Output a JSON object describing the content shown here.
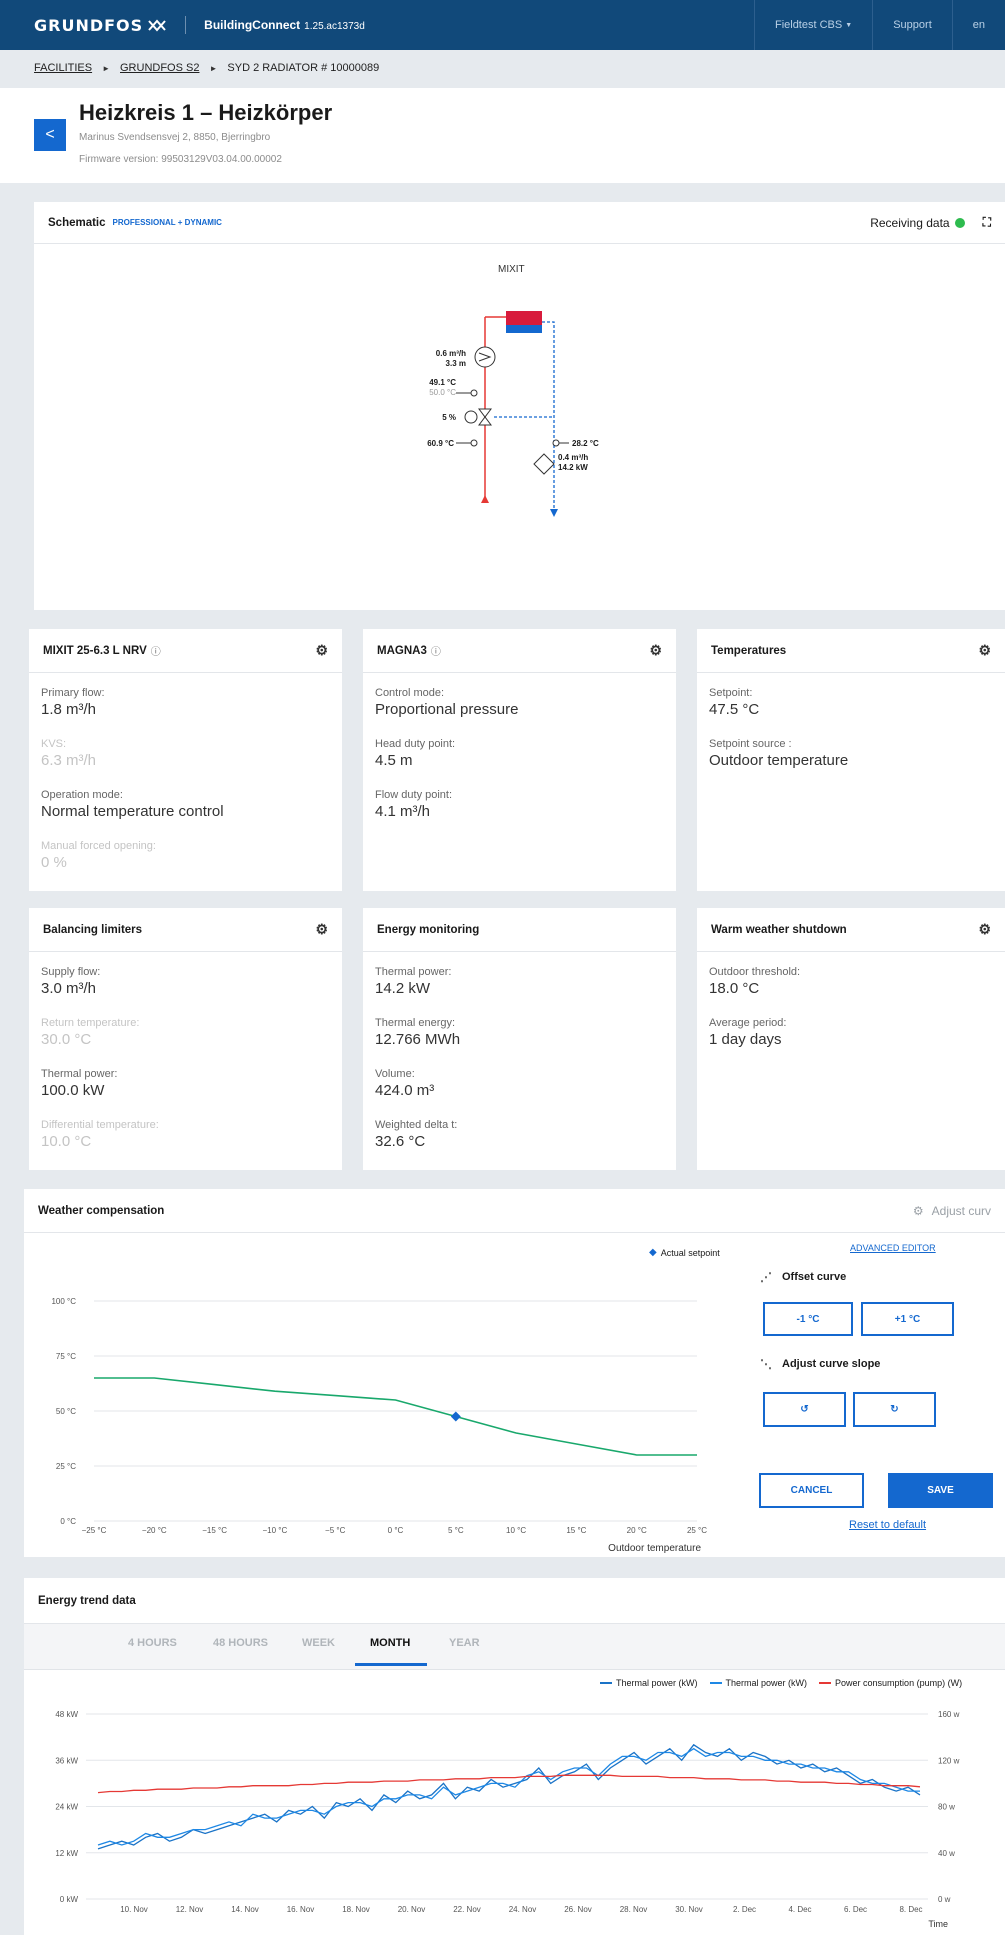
{
  "topbar": {
    "logo": "GRUNDFOS",
    "app_name": "BuildingConnect",
    "app_version": "1.25.ac1373d",
    "user_menu": "Fieldtest CBS",
    "support": "Support",
    "language": "en"
  },
  "breadcrumb": {
    "items": [
      "FACILITIES",
      "GRUNDFOS S2",
      "SYD 2 RADIATOR # 10000089"
    ]
  },
  "header": {
    "title": "Heizkreis 1 – Heizkörper",
    "address": "Marinus Svendsensvej 2, 8850, Bjerringbro",
    "firmware": "Firmware version: 99503129V03.04.00.00002"
  },
  "schematic": {
    "title": "Schematic",
    "badge": "PROFESSIONAL + DYNAMIC",
    "status": "Receiving data",
    "status_color": "#2dbb4e",
    "diagram_title": "MIXIT",
    "labels": {
      "pump_flow": "0.6 m³/h",
      "pump_head": "3.3 m",
      "temp_supply": "49.1 °C",
      "temp_setpoint": "50.0 °C",
      "valve": "5 %",
      "temp_primary": "60.9 °C",
      "temp_return": "28.2 °C",
      "meter_flow": "0.4 m³/h",
      "meter_power": "14.2 kW"
    }
  },
  "cards": {
    "mixit": {
      "title": "MIXIT 25-6.3 L NRV",
      "fields": [
        {
          "label": "Primary flow:",
          "value": "1.8 m³/h"
        },
        {
          "label": "KVS:",
          "value": "6.3 m³/h"
        },
        {
          "label": "Operation mode:",
          "value": "Normal temperature control"
        },
        {
          "label": "Manual forced opening:",
          "value": "0 %"
        }
      ]
    },
    "magna": {
      "title": "MAGNA3",
      "fields": [
        {
          "label": "Control mode:",
          "value": "Proportional pressure"
        },
        {
          "label": "Head duty point:",
          "value": "4.5 m"
        },
        {
          "label": "Flow duty point:",
          "value": "4.1 m³/h"
        }
      ]
    },
    "temps": {
      "title": "Temperatures",
      "fields": [
        {
          "label": "Setpoint:",
          "value": "47.5 °C"
        },
        {
          "label": "Setpoint source :",
          "value": "Outdoor temperature"
        }
      ]
    },
    "balancing": {
      "title": "Balancing limiters",
      "fields": [
        {
          "label": "Supply flow:",
          "value": "3.0 m³/h"
        },
        {
          "label": "Return temperature:",
          "value": "30.0 °C"
        },
        {
          "label": "Thermal power:",
          "value": "100.0 kW"
        },
        {
          "label": "Differential temperature:",
          "value": "10.0 °C"
        }
      ]
    },
    "energy": {
      "title": "Energy monitoring",
      "fields": [
        {
          "label": "Thermal power:",
          "value": "14.2 kW"
        },
        {
          "label": "Thermal energy:",
          "value": "12.766 MWh"
        },
        {
          "label": "Volume:",
          "value": "424.0 m³"
        },
        {
          "label": "Weighted delta t:",
          "value": "32.6 °C"
        }
      ]
    },
    "warm": {
      "title": "Warm weather shutdown",
      "fields": [
        {
          "label": "Outdoor threshold:",
          "value": "18.0 °C"
        },
        {
          "label": "Average period:",
          "value": "1 day days"
        }
      ]
    }
  },
  "weather": {
    "title": "Weather compensation",
    "adjust_curve": "Adjust curv",
    "legend": "Actual setpoint",
    "advanced_editor": "ADVANCED EDITOR",
    "offset_curve": "Offset curve",
    "minus": "-1 °C",
    "plus": "+1 °C",
    "adjust_slope": "Adjust curve slope",
    "cancel": "CANCEL",
    "save": "SAVE",
    "reset": "Reset to default"
  },
  "trend": {
    "title": "Energy trend data",
    "tabs": [
      "4 HOURS",
      "48 HOURS",
      "WEEK",
      "MONTH",
      "YEAR"
    ],
    "active_tab": "MONTH"
  },
  "chart_data": [
    {
      "type": "line",
      "title": "Weather compensation",
      "xlabel": "Outdoor temperature",
      "ylabel": "",
      "x_ticks": [
        "−25 °C",
        "−20 °C",
        "−15 °C",
        "−10 °C",
        "−5 °C",
        "0 °C",
        "5 °C",
        "10 °C",
        "15 °C",
        "20 °C",
        "25 °C"
      ],
      "y_ticks": [
        "0 °C",
        "25 °C",
        "50 °C",
        "75 °C",
        "100 °C"
      ],
      "xlim": [
        -25,
        25
      ],
      "ylim": [
        0,
        100
      ],
      "grid": true,
      "series": [
        {
          "color": "#19a86c",
          "x": [
            -25,
            -20,
            -15,
            -10,
            -5,
            0,
            5,
            10,
            15,
            20,
            25
          ],
          "y": [
            65,
            65,
            62,
            59,
            57,
            55,
            47.5,
            40,
            35,
            30,
            30
          ]
        }
      ],
      "markers": [
        {
          "name": "Actual setpoint",
          "x": 5,
          "y": 47.5,
          "color": "#1468cf"
        }
      ]
    },
    {
      "type": "line",
      "x_ticks": [
        "10. Nov",
        "12. Nov",
        "14. Nov",
        "16. Nov",
        "18. Nov",
        "20. Nov",
        "22. Nov",
        "24. Nov",
        "26. Nov",
        "28. Nov",
        "30. Nov",
        "2. Dec",
        "4. Dec",
        "6. Dec",
        "8. Dec"
      ],
      "xlabel": "Time",
      "y_left_ticks": [
        "0 kW",
        "12 kW",
        "24 kW",
        "36 kW",
        "48 kW"
      ],
      "y_right_ticks": [
        "0 w",
        "40 w",
        "80 w",
        "120 w",
        "160 w"
      ],
      "ylim_left": [
        0,
        48
      ],
      "ylim_right": [
        0,
        160
      ],
      "grid": true,
      "legend_position": "top-right",
      "series": [
        {
          "name": "Thermal power (kW)",
          "color": "#1a73c7",
          "axis": "left",
          "values": [
            13,
            14,
            15,
            14,
            16,
            17,
            15,
            16,
            18,
            17,
            18,
            19,
            20,
            21,
            22,
            20,
            23,
            22,
            24,
            21,
            25,
            24,
            26,
            23,
            27,
            25,
            28,
            26,
            27,
            30,
            26,
            29,
            28,
            31,
            29,
            30,
            31,
            34,
            30,
            32,
            33,
            35,
            31,
            34,
            36,
            38,
            35,
            37,
            39,
            36,
            40,
            38,
            37,
            39,
            36,
            38,
            37,
            35,
            36,
            34,
            35,
            33,
            34,
            32,
            30,
            31,
            29,
            28,
            29,
            27
          ]
        },
        {
          "name": "Thermal power (kW)",
          "color": "#1e88e5",
          "axis": "left",
          "values": [
            14,
            15,
            14,
            15,
            17,
            16,
            16,
            17,
            18,
            18,
            19,
            20,
            19,
            22,
            21,
            21,
            22,
            23,
            23,
            22,
            24,
            25,
            25,
            24,
            26,
            26,
            27,
            27,
            26,
            29,
            27,
            28,
            29,
            30,
            30,
            29,
            32,
            33,
            31,
            33,
            34,
            34,
            32,
            35,
            37,
            37,
            36,
            38,
            38,
            37,
            39,
            37,
            38,
            38,
            37,
            37,
            36,
            36,
            35,
            35,
            34,
            34,
            33,
            33,
            31,
            30,
            30,
            29,
            28,
            28
          ]
        },
        {
          "name": "Power consumption (pump) (W)",
          "color": "#e53935",
          "axis": "right",
          "values": [
            92,
            93,
            93,
            94,
            94,
            95,
            95,
            95,
            96,
            96,
            96,
            97,
            97,
            98,
            98,
            98,
            98,
            99,
            99,
            100,
            100,
            101,
            101,
            101,
            102,
            102,
            102,
            103,
            103,
            103,
            104,
            104,
            104,
            105,
            105,
            105,
            106,
            106,
            106,
            107,
            107,
            107,
            107,
            107,
            106,
            106,
            106,
            106,
            105,
            105,
            105,
            104,
            104,
            104,
            103,
            103,
            103,
            102,
            102,
            101,
            101,
            101,
            100,
            100,
            99,
            99,
            98,
            98,
            98,
            97
          ]
        }
      ]
    }
  ]
}
